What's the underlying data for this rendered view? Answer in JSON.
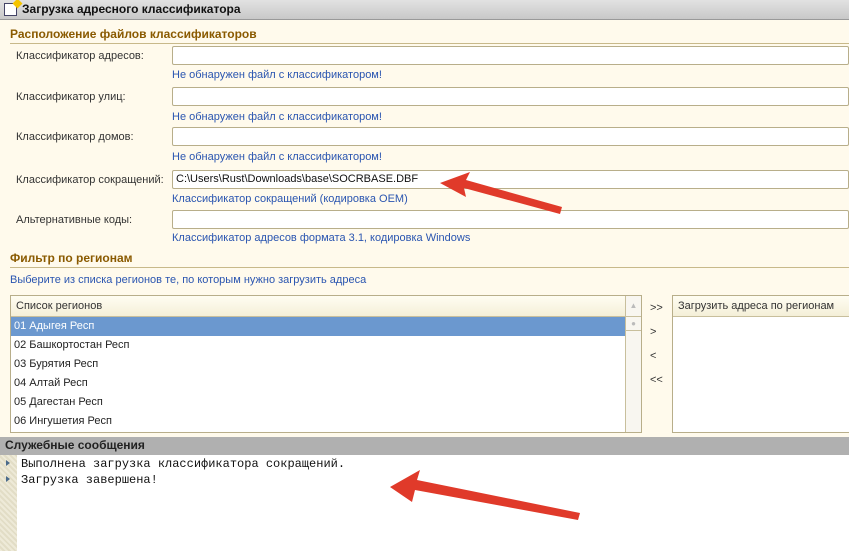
{
  "window": {
    "title": "Загрузка адресного классификатора"
  },
  "files_section": {
    "title": "Расположение файлов классификаторов",
    "fields": [
      {
        "label": "Классификатор адресов:",
        "value": "",
        "hint": "Не обнаружен файл с классификатором!"
      },
      {
        "label": "Классификатор улиц:",
        "value": "",
        "hint": "Не обнаружен файл с классификатором!"
      },
      {
        "label": "Классификатор домов:",
        "value": "",
        "hint": "Не обнаружен файл с классификатором!"
      },
      {
        "label": "Классификатор сокращений:",
        "value": "C:\\Users\\Rust\\Downloads\\base\\SOCRBASE.DBF",
        "hint": "Классификатор сокращений (кодировка OEM)"
      },
      {
        "label": "Альтернативные коды:",
        "value": "",
        "hint": "Классификатор адресов формата 3.1, кодировка Windows"
      }
    ]
  },
  "filter": {
    "title": "Фильтр по регионам",
    "hint": "Выберите из списка регионов те, по которым нужно загрузить адреса",
    "list_header": "Список регионов",
    "regions": [
      "01 Адыгея Респ",
      "02 Башкортостан Респ",
      "03 Бурятия Респ",
      "04 Алтай Респ",
      "05 Дагестан Респ",
      "06 Ингушетия Респ"
    ],
    "selected_index": 0,
    "buttons": {
      "add_all": ">>",
      "add": ">",
      "remove": "<",
      "remove_all": "<<"
    },
    "target_header": "Загрузить адреса по регионам"
  },
  "messages": {
    "title": "Служебные сообщения",
    "items": [
      "Выполнена загрузка классификатора сокращений.",
      "Загрузка завершена!"
    ]
  },
  "colors": {
    "section_title": "#8a5a00",
    "hint": "#2a55b0",
    "selected_row": "#6b98cf",
    "arrow": "#e03a2a"
  }
}
